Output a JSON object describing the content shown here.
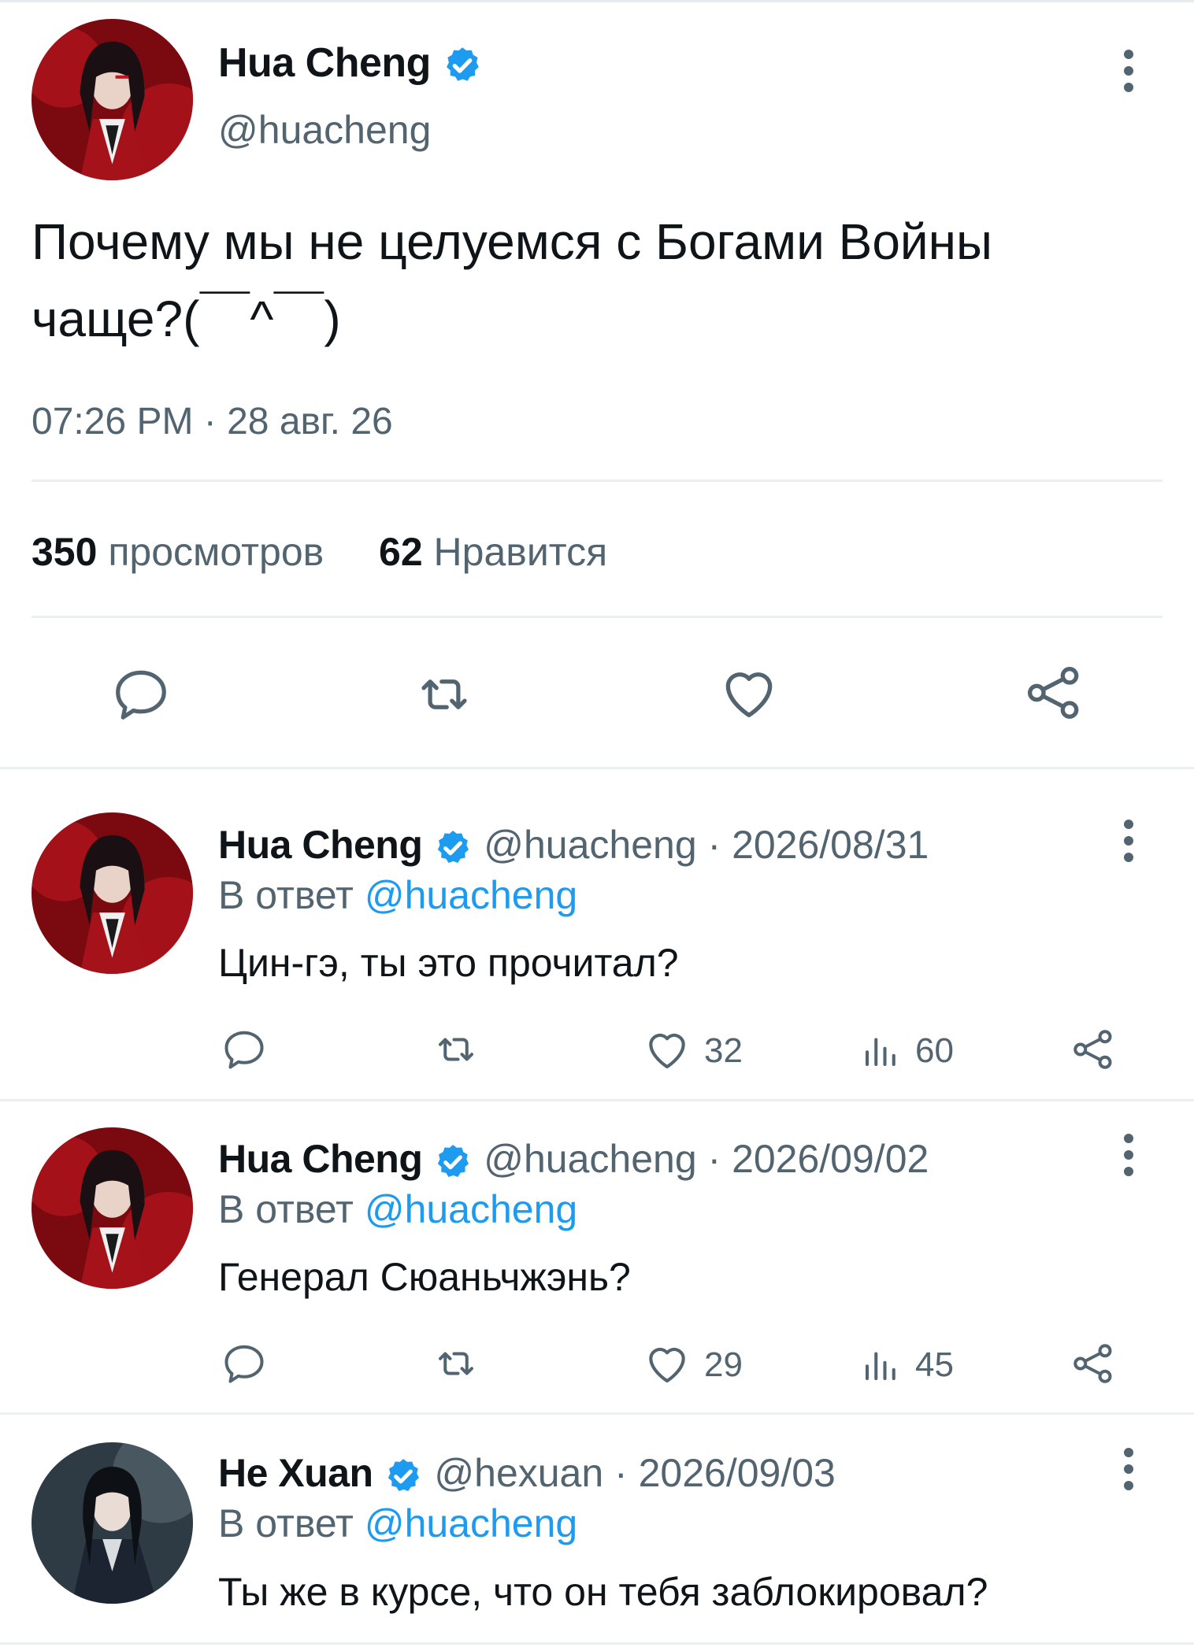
{
  "main_tweet": {
    "name": "Hua Cheng",
    "handle": "@huacheng",
    "text_line1": "Почему мы не целуемся с Богами Войны",
    "text_line2": "чаще?(￣^￣)",
    "timestamp": "07:26 PM · 28 авг. 26",
    "views_count": "350",
    "views_label": "просмотров",
    "likes_count": "62",
    "likes_label": "Нравится"
  },
  "replies": [
    {
      "name": "Hua Cheng",
      "meta": "@huacheng · 2026/08/31",
      "replying_prefix": "В ответ",
      "replying_to": "@huacheng",
      "text": "Цин-гэ, ты это прочитал?",
      "likes": "32",
      "views": "60"
    },
    {
      "name": "Hua Cheng",
      "meta": "@huacheng · 2026/09/02",
      "replying_prefix": "В ответ",
      "replying_to": "@huacheng",
      "text": "Генерал Сюаньчжэнь?",
      "likes": "29",
      "views": "45"
    },
    {
      "name": "He Xuan",
      "meta": "@hexuan · 2026/09/03",
      "replying_prefix": "В ответ",
      "replying_to": "@huacheng",
      "text": "Ты же в курсе, что он тебя заблокировал?"
    }
  ],
  "colors": {
    "accent": "#1d9bf0",
    "muted": "#536471",
    "text": "#0f1419",
    "divider": "#eceff1"
  },
  "icons": [
    "verified-badge-icon",
    "more-options-icon",
    "reply-icon",
    "retweet-icon",
    "like-icon",
    "share-icon",
    "views-icon"
  ]
}
